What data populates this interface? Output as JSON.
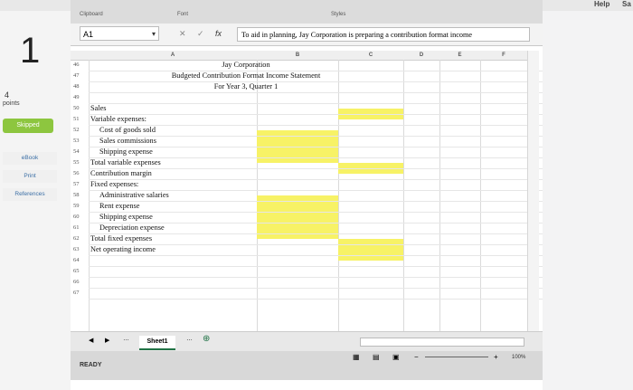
{
  "top": {
    "help": "Help",
    "sa": "Sa"
  },
  "left": {
    "question_number": "1",
    "points_value": "4",
    "points_label": "points",
    "skipped": "Skipped",
    "ebook": "eBook",
    "print": "Print",
    "references": "References"
  },
  "ribbon": {
    "clipboard": "Clipboard",
    "font": "Font",
    "styles": "Styles"
  },
  "formula_bar": {
    "name_box": "A1",
    "formula_text": "To aid in planning, Jay Corporation is preparing a contribution format income"
  },
  "columns": [
    "A",
    "B",
    "C",
    "D",
    "E",
    "F"
  ],
  "rows": [
    {
      "num": "46",
      "a": "",
      "center": "Jay Corporation"
    },
    {
      "num": "47",
      "a": "",
      "center": "Budgeted Contribution Format Income Statement"
    },
    {
      "num": "48",
      "a": "",
      "center": "For Year 3, Quarter 1"
    },
    {
      "num": "49",
      "a": ""
    },
    {
      "num": "50",
      "a": "Sales"
    },
    {
      "num": "51",
      "a": "Variable expenses:"
    },
    {
      "num": "52",
      "a": "Cost of goods sold"
    },
    {
      "num": "53",
      "a": "Sales commissions"
    },
    {
      "num": "54",
      "a": "Shipping expense"
    },
    {
      "num": "55",
      "a": "Total variable expenses"
    },
    {
      "num": "56",
      "a": "Contribution margin"
    },
    {
      "num": "57",
      "a": "Fixed expenses:"
    },
    {
      "num": "58",
      "a": "Administrative salaries"
    },
    {
      "num": "59",
      "a": "Rent expense"
    },
    {
      "num": "60",
      "a": "Shipping expense"
    },
    {
      "num": "61",
      "a": "Depreciation expense"
    },
    {
      "num": "62",
      "a": "Total fixed expenses"
    },
    {
      "num": "63",
      "a": "Net operating income"
    },
    {
      "num": "64",
      "a": ""
    },
    {
      "num": "65",
      "a": ""
    },
    {
      "num": "66",
      "a": ""
    },
    {
      "num": "67",
      "a": ""
    }
  ],
  "sheet_tab": "Sheet1",
  "status": {
    "ready": "READY",
    "zoom": "100%"
  }
}
